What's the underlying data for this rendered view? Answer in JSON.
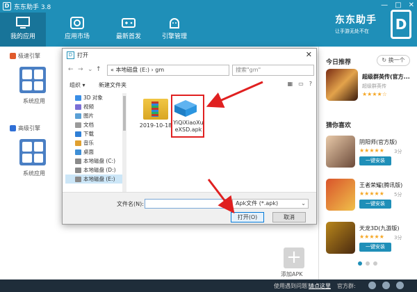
{
  "app": {
    "title": "东东助手 3.8",
    "logo_letter": "D"
  },
  "window_buttons": [
    "—",
    "□",
    "✕"
  ],
  "nav": [
    {
      "label": "我的应用",
      "active": true
    },
    {
      "label": "应用市场"
    },
    {
      "label": "最新首发"
    },
    {
      "label": "引擎管理"
    }
  ],
  "brand": {
    "name": "东东助手",
    "tagline": "让手游无处不在",
    "mark": "D"
  },
  "left": {
    "sections": [
      {
        "header": "极速引擎",
        "caption": "系统应用",
        "color": "#e05a2b"
      },
      {
        "header": "高级引擎",
        "caption": "系统应用",
        "color": "#2f6fd6"
      }
    ]
  },
  "dialog": {
    "title": "打开",
    "path": "«  本地磁盘 (E:)  ›  gm",
    "search_placeholder": "搜索\"gm\"",
    "toolbar": {
      "organize": "组织 ▾",
      "new_folder": "新建文件夹"
    },
    "tree": [
      {
        "label": "3D 对象",
        "color": "#3a8ee6"
      },
      {
        "label": "视频",
        "color": "#7b6fd6"
      },
      {
        "label": "图片",
        "color": "#5aa0d6"
      },
      {
        "label": "文档",
        "color": "#9a9a9a"
      },
      {
        "label": "下载",
        "color": "#2f7fd6"
      },
      {
        "label": "音乐",
        "color": "#e0a030"
      },
      {
        "label": "桌面",
        "color": "#3f8fd6"
      },
      {
        "label": "本地磁盘 (C:)",
        "color": "#8a8a8a"
      },
      {
        "label": "本地磁盘 (D:)",
        "color": "#8a8a8a"
      },
      {
        "label": "本地磁盘 (E:)",
        "color": "#8a8a8a",
        "selected": true
      }
    ],
    "files": [
      {
        "name": "2019-10-18"
      },
      {
        "name": "YiQiXiaoXueXSD.apk"
      }
    ],
    "filename_label": "文件名(N):",
    "filetype": "Apk文件 (*.apk)",
    "open_label": "打开(O)",
    "cancel_label": "取消"
  },
  "right": {
    "today_title": "今日推荐",
    "refresh_label": "↻ 换一个",
    "featured": {
      "name": "超级群英传(官方...",
      "sub": "超级群英传",
      "stars": "★★★★☆"
    },
    "guess_title": "猜你喜欢",
    "games": [
      {
        "name": "阴阳师(官方版)",
        "stars": "★★★★★",
        "score": "3分",
        "btn": "一键安装",
        "color1": "#e8c9a8",
        "color2": "#6b4a3a"
      },
      {
        "name": "王者荣耀(腾讯版)",
        "stars": "★★★★★",
        "score": "5分",
        "btn": "一键安装",
        "color1": "#d9542b",
        "color2": "#f0c04a"
      },
      {
        "name": "天龙3D(九游版)",
        "stars": "★★★★★",
        "score": "3分",
        "btn": "一键安装",
        "color1": "#b8861b",
        "color2": "#4a2a10"
      }
    ]
  },
  "add_apk": {
    "plus": "+",
    "label": "添加APK"
  },
  "statusbar": {
    "question": "使用遇到问题?",
    "link": "请点这里",
    "share": "官方群:"
  },
  "accent": "#1f8fb8",
  "highlight": "#e02020"
}
